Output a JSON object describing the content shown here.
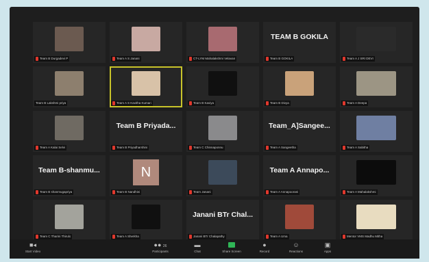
{
  "colors": {
    "background": "#cfe6ec",
    "window": "#1e1e1e",
    "tile": "#262626",
    "active_speaker": "#c9c42a",
    "muted_mic": "#e0382d",
    "share_button": "#2fb556"
  },
  "grid": {
    "tiles": [
      {
        "label": "Team B Durgadevi P",
        "big": "",
        "thumb": "#6b5a50",
        "muted": true
      },
      {
        "label": "Team A S Janani",
        "big": "",
        "thumb": "#c8a9a2",
        "muted": true
      },
      {
        "label": "CT-LYM Mahalakshmi Velavan",
        "big": "",
        "thumb": "#a86a70",
        "muted": true
      },
      {
        "label": "Team B GOKILA",
        "big": "TEAM B GOKILA",
        "thumb": "",
        "muted": true
      },
      {
        "label": "Team A J SRI DEVI",
        "big": "",
        "thumb": "#2a2a2a",
        "muted": true
      },
      {
        "label": "Team B Lakshmi priya",
        "big": "",
        "thumb": "#8d7f6e",
        "muted": false
      },
      {
        "label": "Team A S Kavitha Kumari",
        "big": "",
        "thumb": "#d8c2a8",
        "muted": true,
        "active": true
      },
      {
        "label": "Team B Kaviya",
        "big": "",
        "thumb": "#101010",
        "muted": true
      },
      {
        "label": "Team B Divya",
        "big": "",
        "thumb": "#c9a27a",
        "muted": true
      },
      {
        "label": "Team A Deepa",
        "big": "",
        "thumb": "#9c9584",
        "muted": true
      },
      {
        "label": "Team A Kalai Selvi",
        "big": "",
        "thumb": "#6f6a62",
        "muted": true
      },
      {
        "label": "Team B Priyadharshini",
        "big": "Team B Priyada...",
        "thumb": "",
        "muted": true
      },
      {
        "label": "Team C Chinnaponnu",
        "big": "",
        "thumb": "#8a8a8c",
        "muted": true
      },
      {
        "label": "Team A Sangeetha",
        "big": "Team_A]Sangee...",
        "thumb": "",
        "muted": true
      },
      {
        "label": "Team A Sabitha",
        "big": "",
        "thumb": "#6f7fa2",
        "muted": true
      },
      {
        "label": "Team B shanmugapriya",
        "big": "Team  B-shanmu...",
        "thumb": "",
        "muted": true
      },
      {
        "label": "Team B Nandhini",
        "big": "",
        "thumb": "",
        "letter": "N",
        "muted": true
      },
      {
        "label": "Team Janani",
        "big": "",
        "thumb": "#3c4a5a",
        "muted": true
      },
      {
        "label": "Team A Annapoorani",
        "big": "Team A  Annapo...",
        "thumb": "",
        "muted": true
      },
      {
        "label": "Team A Mahalakshmi",
        "big": "",
        "thumb": "#0c0c0c",
        "muted": true
      },
      {
        "label": "Team C Tharini Thirulo",
        "big": "",
        "thumb": "#a3a39c",
        "muted": true
      },
      {
        "label": "Team A Sherkha",
        "big": "",
        "thumb": "#101010",
        "muted": true
      },
      {
        "label": "Janani BTr Chalapathy",
        "big": "Janani BTr Chal...",
        "thumb": "",
        "muted": true
      },
      {
        "label": "Team A Uma",
        "big": "",
        "thumb": "#a04a3a",
        "muted": true
      },
      {
        "label": "Mentor VMS Madhu Mitha",
        "big": "",
        "thumb": "#e8dcc0",
        "muted": true
      }
    ]
  },
  "toolbar": {
    "start_video": "Start Video",
    "participants": "Participants",
    "participants_count": "26",
    "chat": "Chat",
    "share_screen": "Share Screen",
    "record": "Record",
    "reactions": "Reactions",
    "apps": "Apps"
  }
}
